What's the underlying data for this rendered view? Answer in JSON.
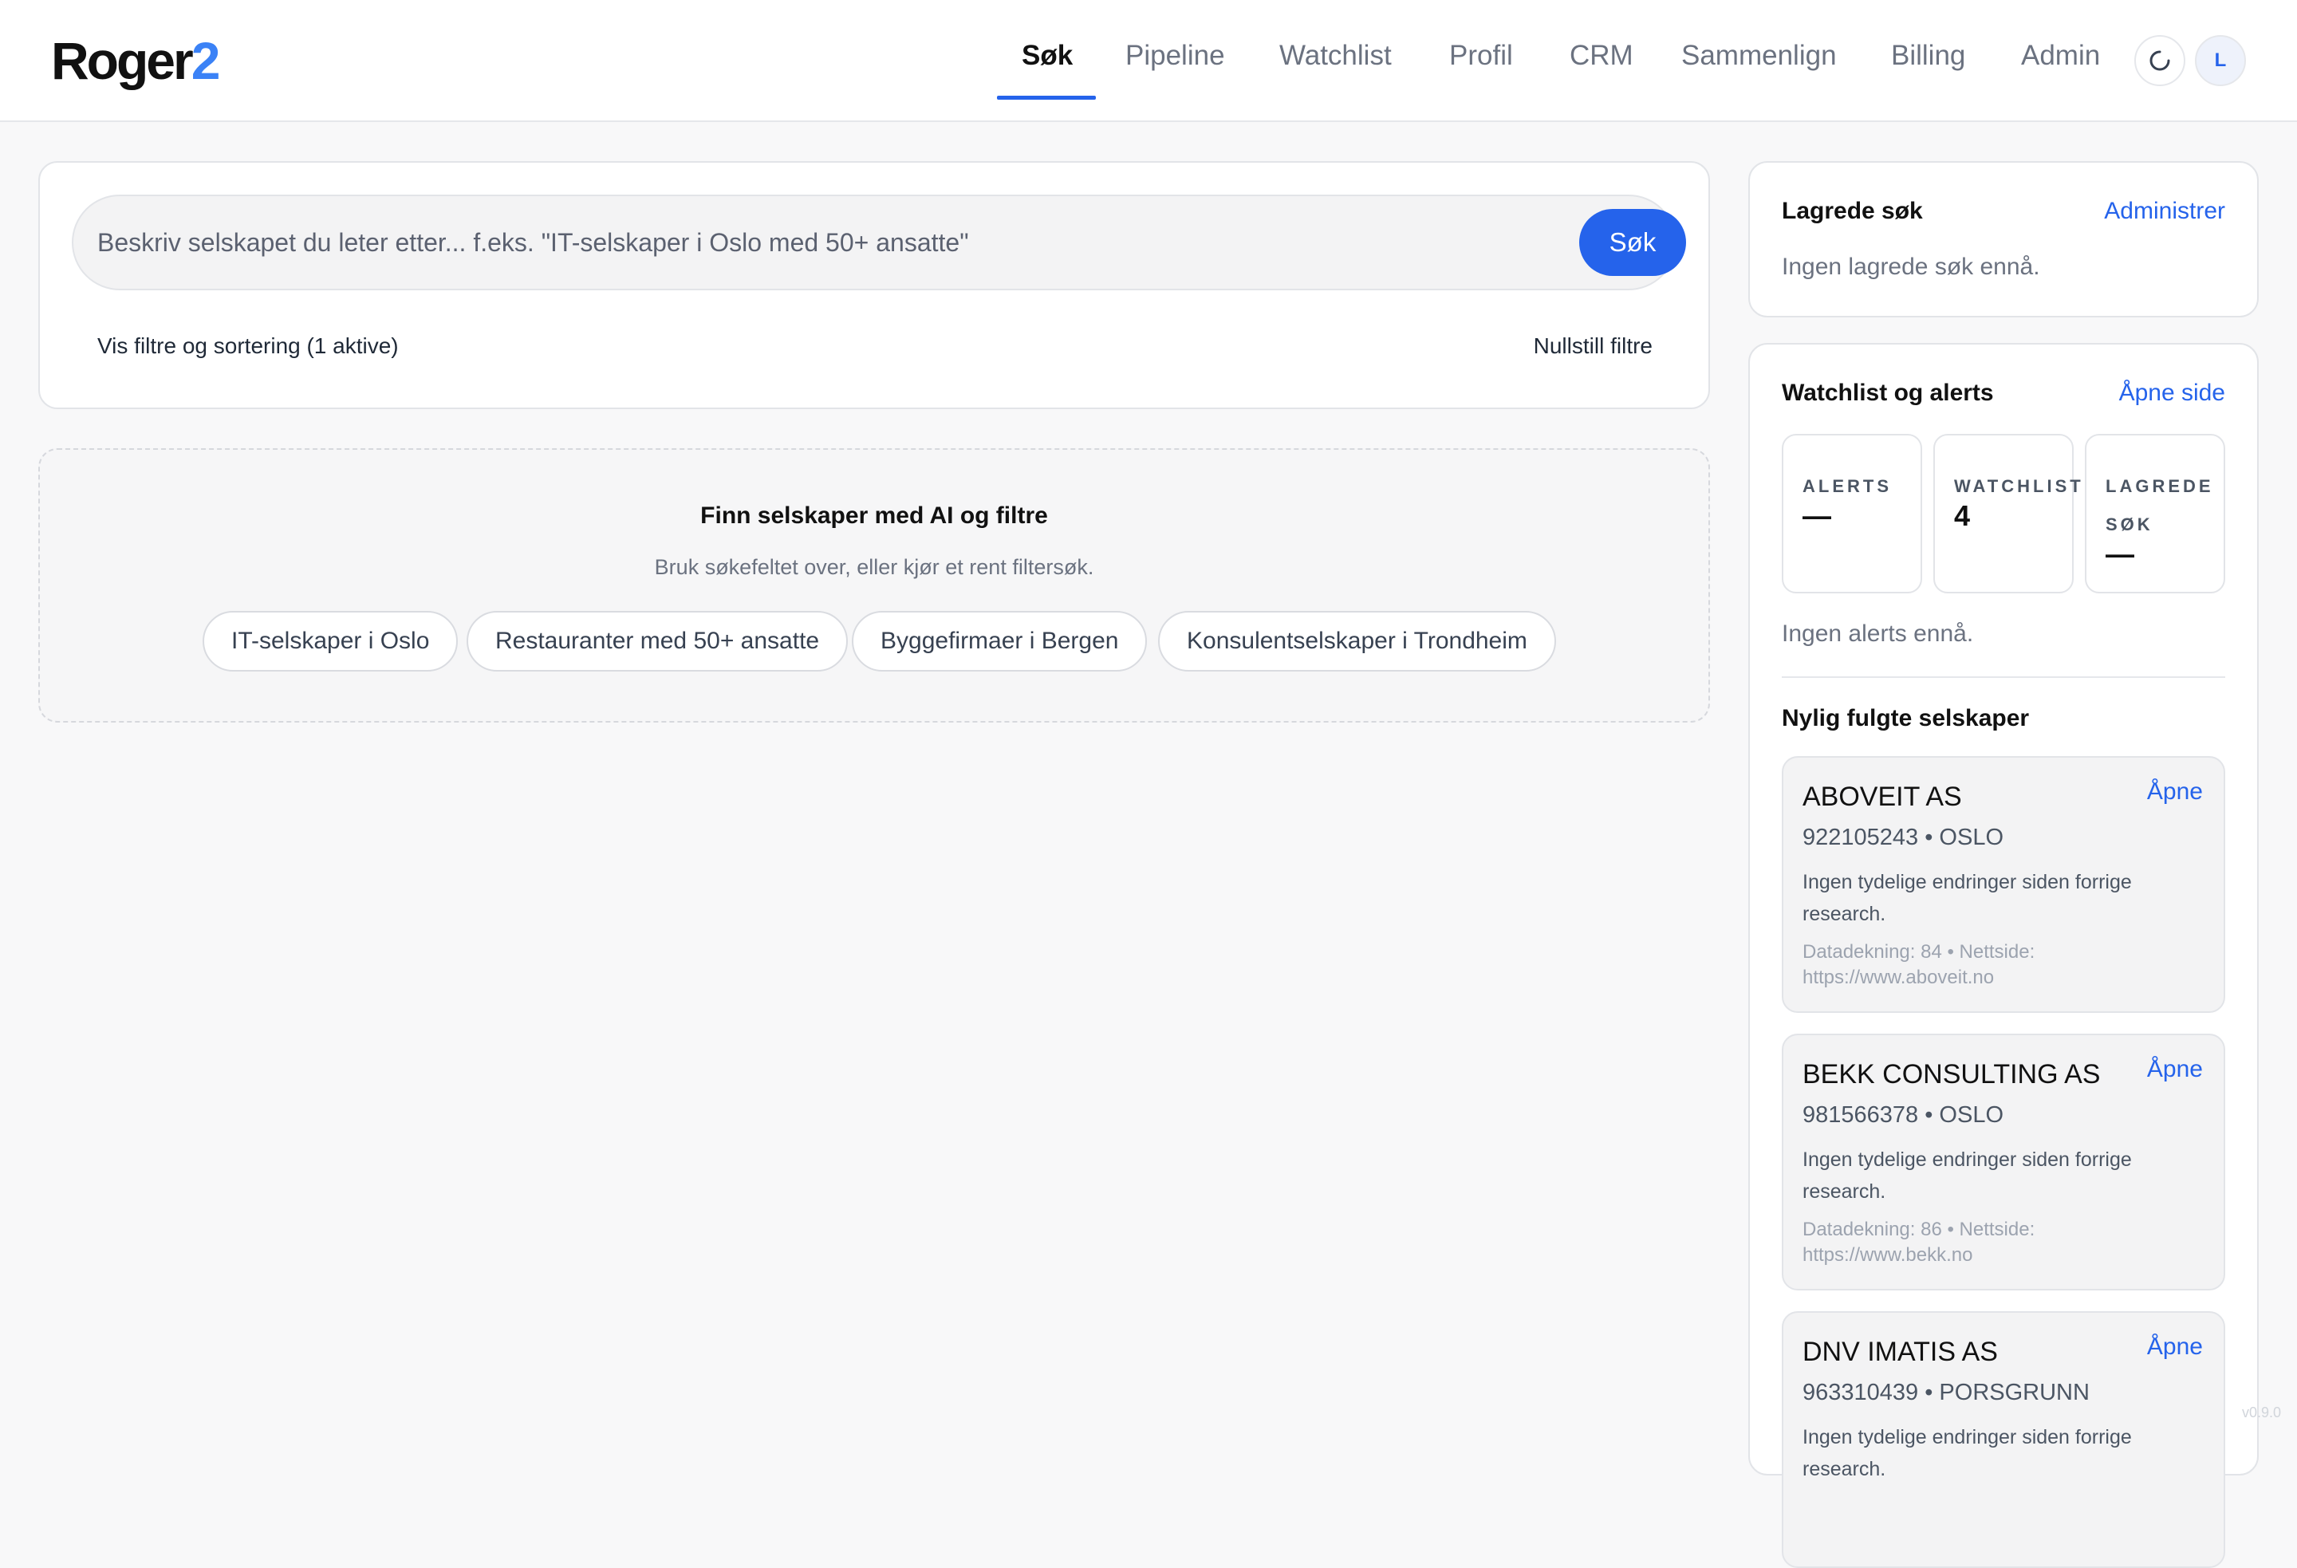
{
  "header": {
    "logo_text": "Roger",
    "logo_accent": "2",
    "nav": [
      {
        "label": "Søk",
        "active": true
      },
      {
        "label": "Pipeline"
      },
      {
        "label": "Watchlist"
      },
      {
        "label": "Profil"
      },
      {
        "label": "CRM"
      },
      {
        "label": "Sammenlign"
      },
      {
        "label": "Billing"
      },
      {
        "label": "Admin"
      }
    ],
    "avatar_initial": "L",
    "refresh_icon": "refresh-icon"
  },
  "search": {
    "placeholder": "Beskriv selskapet du leter etter... f.eks. \"IT-selskaper i Oslo med 50+ ansatte\"",
    "value": "",
    "button_label": "Søk",
    "filters_toggle": "Vis filtre og sortering (1 aktive)",
    "filters_reset": "Nullstill filtre"
  },
  "empty_state": {
    "title": "Finn selskaper med AI og filtre",
    "subtitle": "Bruk søkefeltet over, eller kjør et rent filtersøk.",
    "suggestions": [
      "IT-selskaper i Oslo",
      "Restauranter med 50+ ansatte",
      "Byggefirmaer i Bergen",
      "Konsulentselskaper i Trondheim"
    ]
  },
  "saved_searches": {
    "title": "Lagrede søk",
    "action": "Administrer",
    "empty": "Ingen lagrede søk ennå."
  },
  "watchlist": {
    "title": "Watchlist og alerts",
    "action": "Åpne side",
    "stats": [
      {
        "label": "ALERTS",
        "value": "—"
      },
      {
        "label": "WATCHLIST",
        "value": "4"
      },
      {
        "label": "LAGREDE SØK",
        "value": "—"
      }
    ],
    "alerts_empty": "Ingen alerts ennå.",
    "recent_title": "Nylig fulgte selskaper",
    "companies": [
      {
        "name": "ABOVEIT AS",
        "open": "Åpne",
        "meta": "922105243 • OSLO",
        "note": "Ingen tydelige endringer siden forrige research.",
        "coverage": "Datadekning: 84 • Nettside: https://www.aboveit.no"
      },
      {
        "name": "BEKK CONSULTING AS",
        "open": "Åpne",
        "meta": "981566378 • OSLO",
        "note": "Ingen tydelige endringer siden forrige research.",
        "coverage": "Datadekning: 86 • Nettside: https://www.bekk.no"
      },
      {
        "name": "DNV IMATIS AS",
        "open": "Åpne",
        "meta": "963310439 • PORSGRUNN",
        "note": "Ingen tydelige endringer siden forrige research.",
        "coverage": ""
      }
    ]
  },
  "footer": {
    "version": "v0.9.0"
  },
  "colors": {
    "accent": "#2563eb",
    "logo_accent": "#3b82f6",
    "background": "#f8f8f9"
  }
}
